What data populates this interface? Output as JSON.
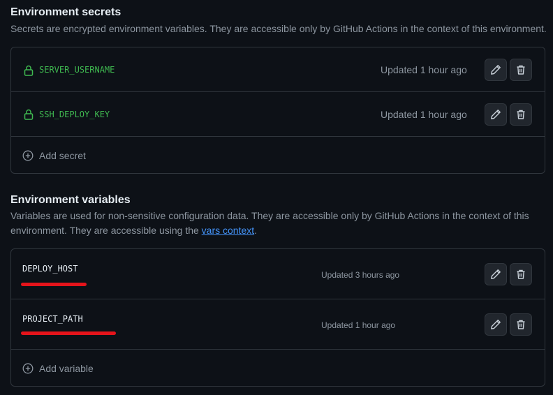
{
  "secrets_section": {
    "title": "Environment secrets",
    "description": "Secrets are encrypted environment variables. They are accessible only by GitHub Actions in the context of this environment.",
    "items": [
      {
        "name": "SERVER_USERNAME",
        "updated": "Updated 1 hour ago",
        "icon": "lock-icon"
      },
      {
        "name": "SSH_DEPLOY_KEY",
        "updated": "Updated 1 hour ago",
        "icon": "lock-icon"
      }
    ],
    "add_label": "Add secret"
  },
  "variables_section": {
    "title": "Environment variables",
    "description_prefix": "Variables are used for non-sensitive configuration data. They are accessible only by GitHub Actions in the context of this environment. They are accessible using the ",
    "description_link": "vars context",
    "description_suffix": ".",
    "items": [
      {
        "name": "DEPLOY_HOST",
        "updated": "Updated 3 hours ago"
      },
      {
        "name": "PROJECT_PATH",
        "updated": "Updated 1 hour ago"
      }
    ],
    "add_label": "Add variable"
  },
  "colors": {
    "background": "#0d1117",
    "border": "#30363d",
    "secret_green": "#3fb950",
    "muted_text": "#8d96a0",
    "link_blue": "#4493f8",
    "redaction_red": "#e5141b"
  }
}
